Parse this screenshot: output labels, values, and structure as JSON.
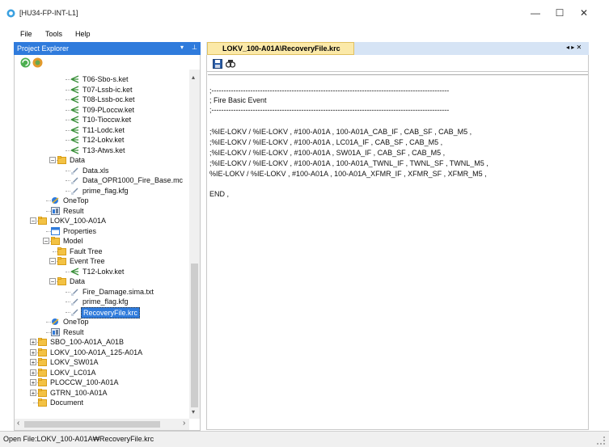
{
  "window": {
    "title": "[HU34-FP-INT-L1]",
    "minimize": "—",
    "maximize": "☐",
    "close": "✕"
  },
  "menu": [
    "File",
    "Tools",
    "Help"
  ],
  "project_explorer": {
    "title": "Project Explorer",
    "dropdown_glyph": "▾",
    "pin_glyph": "⊥"
  },
  "tree": [
    {
      "label": "T06-Sbo-s.ket",
      "type": "ket"
    },
    {
      "label": "T07-Lssb-ic.ket",
      "type": "ket"
    },
    {
      "label": "T08-Lssb-oc.ket",
      "type": "ket"
    },
    {
      "label": "T09-PLoccw.ket",
      "type": "ket"
    },
    {
      "label": "T10-Tioccw.ket",
      "type": "ket"
    },
    {
      "label": "T11-Lodc.ket",
      "type": "ket"
    },
    {
      "label": "T12-Lokv.ket",
      "type": "ket"
    },
    {
      "label": "T13-Atws.ket",
      "type": "ket"
    },
    {
      "label": "Data",
      "type": "folder"
    },
    {
      "label": "Data.xls",
      "type": "file"
    },
    {
      "label": "Data_OPR1000_Fire_Base.mc",
      "type": "file"
    },
    {
      "label": "prime_flag.kfg",
      "type": "file"
    },
    {
      "label": "OneTop",
      "type": "onetop"
    },
    {
      "label": "Result",
      "type": "result"
    },
    {
      "label": "LOKV_100-A01A",
      "type": "folder"
    },
    {
      "label": "Properties",
      "type": "props"
    },
    {
      "label": "Model",
      "type": "folder"
    },
    {
      "label": "Fault Tree",
      "type": "folder"
    },
    {
      "label": "Event Tree",
      "type": "folder"
    },
    {
      "label": "T12-Lokv.ket",
      "type": "ket"
    },
    {
      "label": "Data",
      "type": "folder"
    },
    {
      "label": "Fire_Damage.sima.txt",
      "type": "file"
    },
    {
      "label": "prime_flag.kfg",
      "type": "file"
    },
    {
      "label": "RecoveryFile.krc",
      "type": "file",
      "selected": true
    },
    {
      "label": "OneTop",
      "type": "onetop"
    },
    {
      "label": "Result",
      "type": "result"
    },
    {
      "label": "SBO_100-A01A_A01B",
      "type": "folder"
    },
    {
      "label": "LOKV_100-A01A_125-A01A",
      "type": "folder"
    },
    {
      "label": "LOKV_SW01A",
      "type": "folder"
    },
    {
      "label": "LOKV_LC01A",
      "type": "folder"
    },
    {
      "label": "PLOCCW_100-A01A",
      "type": "folder"
    },
    {
      "label": "GTRN_100-A01A",
      "type": "folder"
    },
    {
      "label": "Document",
      "type": "folder"
    }
  ],
  "document": {
    "tab_label": "LOKV_100-A01A\\RecoveryFile.krc",
    "tab_controls": "◂ ▸ ✕",
    "lines": [
      ";--------------------------------------------------------------------------------------------------",
      "; Fire Basic Event",
      ";--------------------------------------------------------------------------------------------------",
      "",
      ";%IE-LOKV / %IE-LOKV , #100-A01A , 100-A01A_CAB_IF , CAB_SF , CAB_M5 ,",
      ";%IE-LOKV / %IE-LOKV , #100-A01A , LC01A_IF , CAB_SF , CAB_M5 ,",
      ";%IE-LOKV / %IE-LOKV , #100-A01A , SW01A_IF , CAB_SF , CAB_M5 ,",
      ";%IE-LOKV / %IE-LOKV , #100-A01A , 100-A01A_TWNL_IF , TWNL_SF , TWNL_M5 ,",
      "%IE-LOKV / %IE-LOKV , #100-A01A , 100-A01A_XFMR_IF , XFMR_SF , XFMR_M5 ,",
      "",
      "END ,"
    ]
  },
  "status": {
    "text": "Open File:LOKV_100-A01A₩RecoveryFile.krc"
  },
  "scroll": {
    "up": "▴",
    "down": "▾",
    "left": "‹",
    "right": "›"
  },
  "colors": {
    "accent": "#2f7bdc",
    "tab_active": "#fbe9a8",
    "folder": "#f3c244"
  }
}
